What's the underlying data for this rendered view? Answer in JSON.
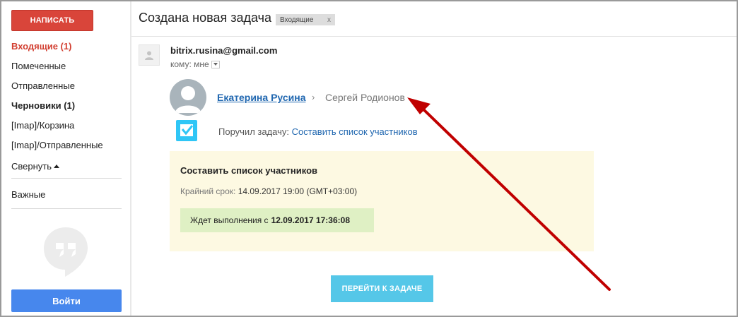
{
  "sidebar": {
    "compose_label": "НАПИСАТЬ",
    "items": [
      {
        "label": "Входящие (1)"
      },
      {
        "label": "Помеченные"
      },
      {
        "label": "Отправленные"
      },
      {
        "label": "Черновики (1)"
      },
      {
        "label": "[Imap]/Корзина"
      },
      {
        "label": "[Imap]/Отправленные"
      }
    ],
    "collapse_label": "Свернуть",
    "important_label": "Важные",
    "signin_label": "Войти"
  },
  "message": {
    "subject": "Создана новая задача",
    "label": "Входящие",
    "label_close": "x",
    "sender_email": "bitrix.rusina@gmail.com",
    "recipient_text": "кому: мне"
  },
  "task": {
    "author": "Екатерина Русина",
    "separator": "›",
    "assignee": "Сергей Родионов",
    "assigned_prefix": "Поручил задачу:",
    "assigned_link": "Составить список участников",
    "title": "Составить список участников",
    "deadline_label": "Крайний срок:",
    "deadline_value": "14.09.2017 19:00 (GMT+03:00)",
    "status_prefix": "Ждет выполнения с",
    "status_date": "12.09.2017 17:36:08",
    "go_button": "ПЕРЕЙТИ К ЗАДАЧЕ"
  },
  "colors": {
    "compose": "#d9453a",
    "active_nav": "#d23f31",
    "signin": "#4787ed",
    "link": "#2067b0",
    "card_bg": "#fdf9e2",
    "status_bg": "#dff0c4",
    "go_button": "#55c7e8",
    "annotation_arrow": "#c00000"
  },
  "icons": {
    "sender_avatar": "person-icon",
    "person_avatar": "user-silhouette-icon",
    "task": "checkbox-task-icon",
    "hangouts": "hangouts-quote-icon",
    "annotation": "red-arrow-annotation"
  }
}
